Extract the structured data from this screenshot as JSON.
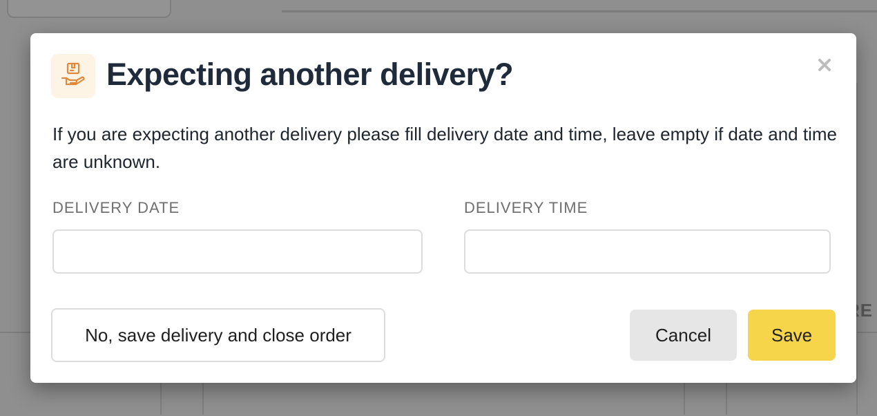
{
  "background": {
    "partial_text": "RE"
  },
  "modal": {
    "title": "Expecting another delivery?",
    "icon": "package-hand-icon",
    "close_icon": "close-icon",
    "description": "If you are expecting another delivery please fill delivery date and time, leave empty if date and time are unknown.",
    "fields": {
      "date": {
        "label": "DELIVERY DATE",
        "value": "",
        "placeholder": ""
      },
      "time": {
        "label": "DELIVERY TIME",
        "value": "",
        "placeholder": ""
      }
    },
    "buttons": {
      "secondary": "No, save delivery and close order",
      "cancel": "Cancel",
      "save": "Save"
    },
    "colors": {
      "title": "#1f2b3a",
      "icon_accent": "#e0893a",
      "icon_bg": "#fdf4e6",
      "save_bg": "#f7d54a",
      "cancel_bg": "#e6e6e6",
      "overlay": "#8f8f8f"
    }
  }
}
